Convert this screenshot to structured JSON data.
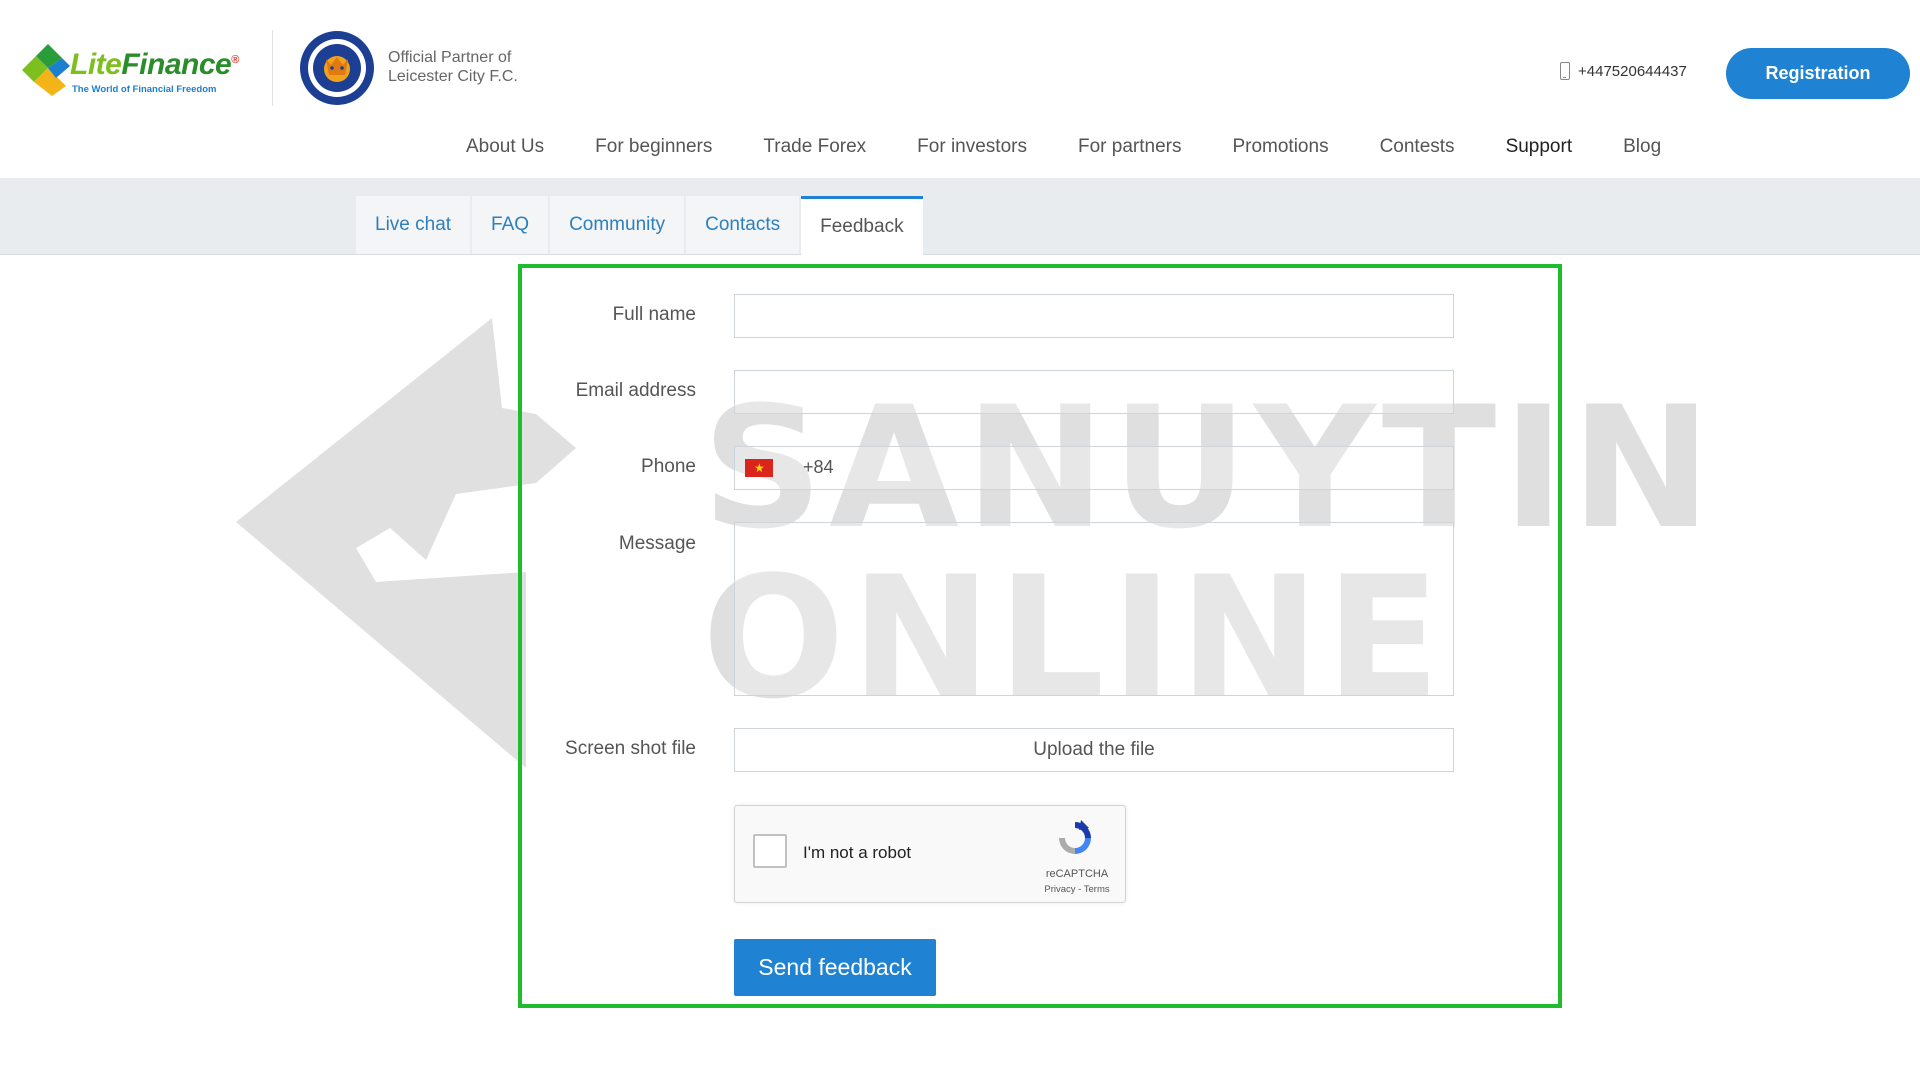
{
  "brand": {
    "name_part1": "Lite",
    "name_part2": "Finance",
    "registered": "®",
    "tagline": "The World of Financial Freedom",
    "partner_line1": "Official Partner of",
    "partner_line2": "Leicester City F.C."
  },
  "header": {
    "phone": "+447520644437",
    "registration_label": "Registration"
  },
  "nav": {
    "items": [
      "About Us",
      "For beginners",
      "Trade Forex",
      "For investors",
      "For partners",
      "Promotions",
      "Contests",
      "Support",
      "Blog"
    ],
    "active": "Support"
  },
  "tabs": {
    "items": [
      "Live chat",
      "FAQ",
      "Community",
      "Contacts",
      "Feedback"
    ],
    "active": "Feedback"
  },
  "form": {
    "full_name_label": "Full name",
    "full_name_value": "",
    "email_label": "Email address",
    "email_value": "",
    "phone_label": "Phone",
    "phone_code": "+84",
    "message_label": "Message",
    "message_value": "",
    "screenshot_label": "Screen shot file",
    "upload_label": "Upload the file",
    "submit_label": "Send feedback"
  },
  "recaptcha": {
    "label": "I'm not a robot",
    "brand": "reCAPTCHA",
    "links": "Privacy - Terms",
    "checked": false
  },
  "watermark": {
    "line1": "SANUYTIN",
    "line2": "ONLINE"
  },
  "colors": {
    "accent_blue": "#1f82d2",
    "highlight_green": "#1fbd2e",
    "subnav_bg": "#e8ecef"
  }
}
